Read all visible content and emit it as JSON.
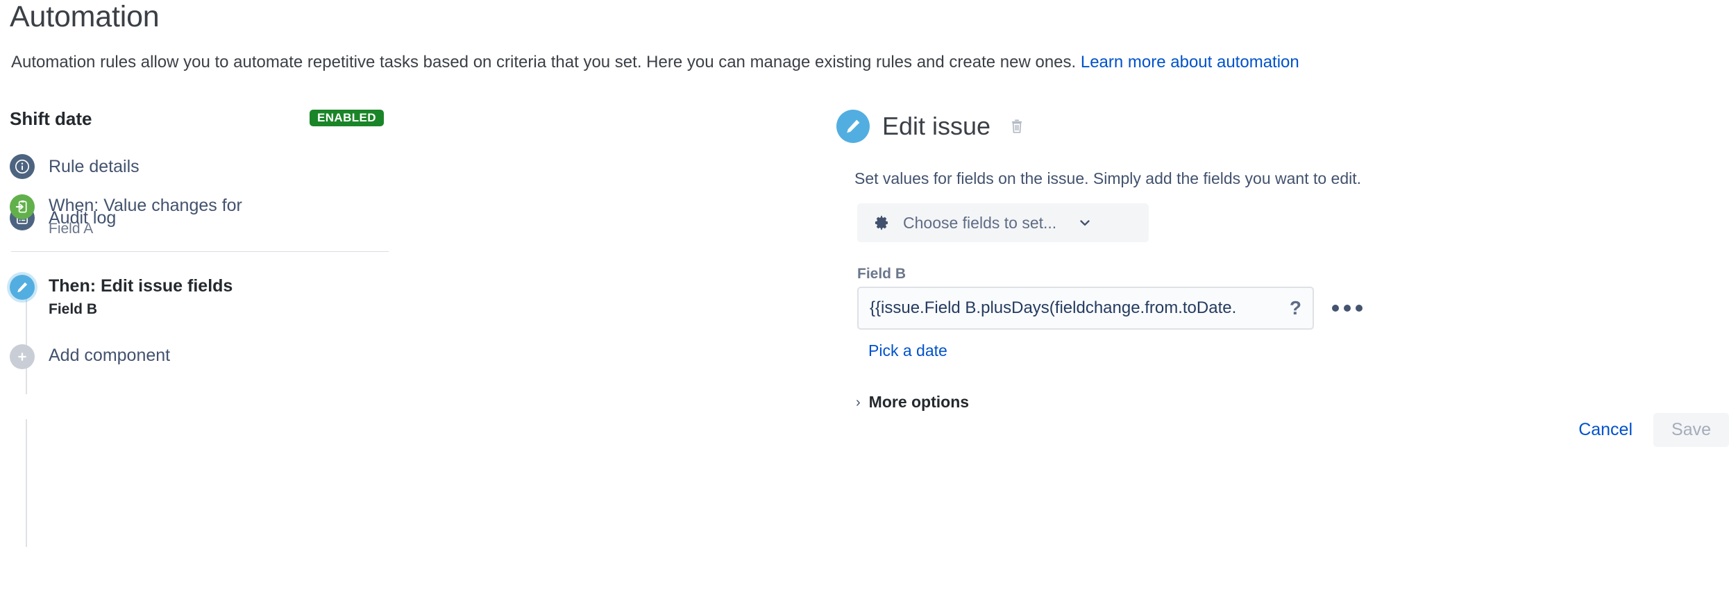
{
  "header": {
    "title": "Automation",
    "description_before_link": "Automation rules allow you to automate repetitive tasks based on criteria that you set. Here you can manage existing rules and create new ones. ",
    "link_label": "Learn more about automation"
  },
  "rule": {
    "name": "Shift date",
    "status_badge": "ENABLED",
    "nav": [
      {
        "label": "Rule details",
        "icon": "info-circle-icon"
      },
      {
        "label": "Audit log",
        "icon": "document-list-icon"
      }
    ],
    "steps": [
      {
        "title": "When: Value changes for",
        "subtitle": "Field A",
        "icon": "trigger-icon",
        "selected": false
      },
      {
        "title": "Then: Edit issue fields",
        "subtitle": "Field B",
        "icon": "pencil-icon",
        "selected": true
      }
    ],
    "add_component_label": "Add component",
    "add_component_icon": "plus-icon"
  },
  "panel": {
    "icon": "pencil-icon",
    "title": "Edit issue",
    "delete_icon": "trash-icon",
    "description": "Set values for fields on the issue. Simply add the fields you want to edit.",
    "choose_fields": {
      "icon": "gear-icon",
      "label": "Choose fields to set...",
      "chevron_icon": "chevron-down-icon"
    },
    "field": {
      "label": "Field B",
      "value": "{{issue.Field B.plusDays(fieldchange.from.toDate.",
      "help_icon": "question-mark-icon",
      "more_icon": "ellipsis-icon",
      "pick_date_label": "Pick a date"
    },
    "more_options": {
      "caret_icon": "chevron-right-icon",
      "label": "More options"
    },
    "cancel_label": "Cancel",
    "save_label": "Save"
  },
  "colors": {
    "link": "#0052cc",
    "badge_green": "#1a8528",
    "icon_slate": "#4d6480",
    "icon_green": "#62b04b",
    "icon_blue": "#52aee0",
    "icon_grey": "#c9ced6"
  }
}
